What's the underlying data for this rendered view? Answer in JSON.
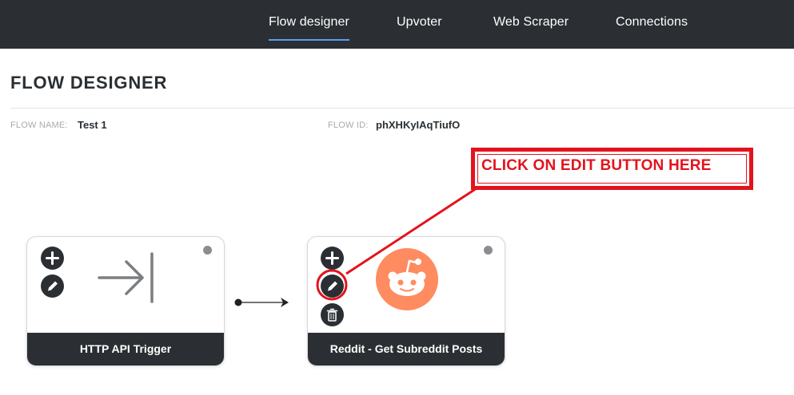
{
  "nav": {
    "tabs": [
      {
        "label": "Flow designer",
        "active": true
      },
      {
        "label": "Upvoter",
        "active": false
      },
      {
        "label": "Web Scraper",
        "active": false
      },
      {
        "label": "Connections",
        "active": false
      }
    ]
  },
  "page": {
    "title": "FLOW DESIGNER",
    "flow_name_label": "FLOW NAME:",
    "flow_name_value": "Test 1",
    "flow_id_label": "FLOW ID:",
    "flow_id_value": "phXHKyIAqTiufO"
  },
  "callout": {
    "text": "CLICK ON EDIT BUTTON HERE",
    "color": "#e3131c"
  },
  "nodes": [
    {
      "title": "HTTP API Trigger",
      "icon": "arrow-to-line-icon",
      "buttons": [
        "add-icon",
        "edit-icon"
      ]
    },
    {
      "title": "Reddit - Get Subreddit Posts",
      "icon": "reddit-icon",
      "icon_color": "#ff8b60",
      "buttons": [
        "add-icon",
        "edit-icon",
        "delete-icon"
      ]
    }
  ],
  "colors": {
    "topbar": "#2b2f33",
    "active_underline": "#5a9cf0",
    "node_footer": "#2b2f33"
  }
}
